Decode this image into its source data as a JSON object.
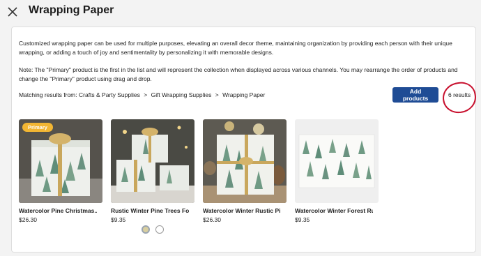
{
  "header": {
    "title": "Wrapping Paper"
  },
  "panel": {
    "description": "Customized wrapping paper can be used for multiple purposes, elevating an overall decor theme, maintaining organization by providing each person with their unique wrapping, or adding a touch of joy and sentimentality by personalizing it with memorable designs.",
    "note": "Note: The \"Primary\" product is the first in the list and will represent the collection when displayed across various channels. You may rearrange the order of products and change the \"Primary\" product using drag and drop.",
    "matching_label": "Matching results from:",
    "breadcrumb": [
      "Crafts & Party Supplies",
      "Gift Wrapping Supplies",
      "Wrapping Paper"
    ],
    "breadcrumb_separator": ">",
    "add_button": "Add products",
    "results_count": "6 results"
  },
  "products": [
    {
      "name": "Watercolor Pine Christmas...",
      "price": "$26.30",
      "badge": "Primary"
    },
    {
      "name": "Rustic Winter Pine Trees Fore...",
      "price": "$9.35"
    },
    {
      "name": "Watercolor Winter Rustic Pine...",
      "price": "$26.30"
    },
    {
      "name": "Watercolor Winter Forest Rus...",
      "price": "$9.35"
    }
  ],
  "colors": {
    "accent": "#1f4c95",
    "badge": "#f2b633",
    "annotation": "#c8102e"
  }
}
